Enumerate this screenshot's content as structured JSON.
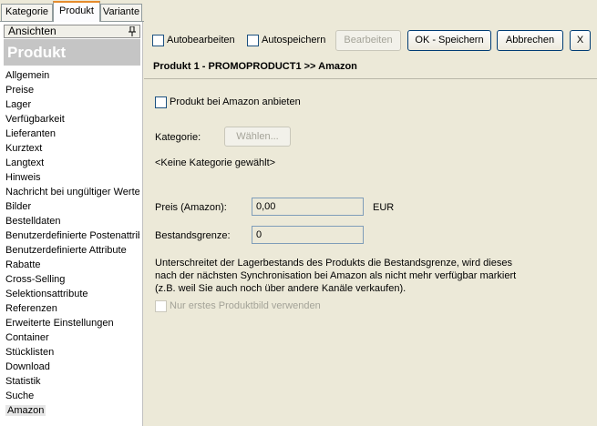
{
  "tabs": [
    {
      "label": "Kategorie",
      "active": false
    },
    {
      "label": "Produkt",
      "active": true
    },
    {
      "label": "Variante",
      "active": false
    }
  ],
  "sidebar": {
    "header": "Ansichten",
    "banner": "Produkt",
    "items": [
      "Allgemein",
      "Preise",
      "Lager",
      "Verfügbarkeit",
      "Lieferanten",
      "Kurztext",
      "Langtext",
      "Hinweis",
      "Nachricht bei ungültiger Werte",
      "Bilder",
      "Bestelldaten",
      "Benutzerdefinierte Postenattribute",
      "Benutzerdefinierte Attribute",
      "Rabatte",
      "Cross-Selling",
      "Selektionsattribute",
      "Referenzen",
      "Erweiterte Einstellungen",
      "Container",
      "Stücklisten",
      "Download",
      "Statistik",
      "Suche",
      "Amazon"
    ],
    "selected_index": 23
  },
  "toolbar": {
    "autobearbeiten": "Autobearbeiten",
    "autospeichern": "Autospeichern",
    "bearbeiten": "Bearbeiten",
    "ok_speichern": "OK - Speichern",
    "abbrechen": "Abbrechen",
    "close": "X"
  },
  "main": {
    "title": "Produkt 1 - PROMOPRODUCT1 >> Amazon",
    "offer_label": "Produkt bei Amazon anbieten",
    "kategorie_label": "Kategorie:",
    "waehlen_button": "Wählen...",
    "no_category": "<Keine Kategorie gewählt>",
    "price_label": "Preis (Amazon):",
    "price_value": "0,00",
    "currency": "EUR",
    "stock_label": "Bestandsgrenze:",
    "stock_value": "0",
    "info_text": "Unterschreitet der Lagerbestands des Produkts die Bestandsgrenze, wird dieses nach der nächsten Synchronisation bei Amazon als nicht mehr verfügbar markiert (z.B. weil Sie auch noch über andere Kanäle verkaufen).",
    "first_image_label": "Nur erstes Produktbild verwenden"
  }
}
